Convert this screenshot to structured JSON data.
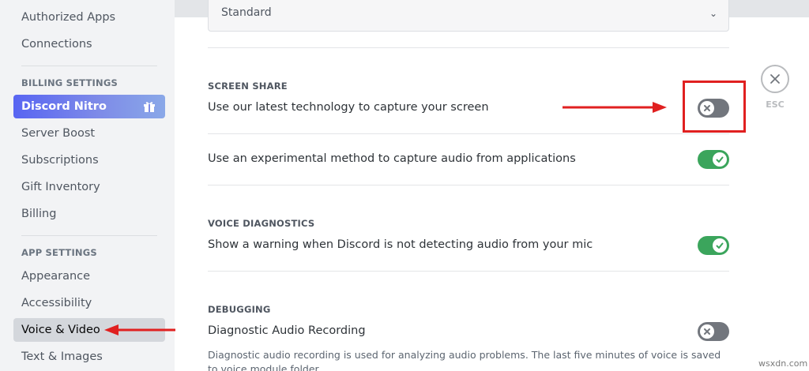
{
  "sidebar": {
    "items_top": [
      "Authorized Apps",
      "Connections"
    ],
    "billing_header": "BILLING SETTINGS",
    "billing_items": [
      "Discord Nitro",
      "Server Boost",
      "Subscriptions",
      "Gift Inventory",
      "Billing"
    ],
    "app_header": "APP SETTINGS",
    "app_items": [
      "Appearance",
      "Accessibility",
      "Voice & Video",
      "Text & Images"
    ],
    "active_item": "Voice & Video"
  },
  "main": {
    "dropdown_value": "Standard",
    "screen_share": {
      "title": "SCREEN SHARE",
      "row1_label": "Use our latest technology to capture your screen",
      "row1_enabled": false,
      "row2_label": "Use an experimental method to capture audio from applications",
      "row2_enabled": true
    },
    "voice_diagnostics": {
      "title": "VOICE DIAGNOSTICS",
      "row_label": "Show a warning when Discord is not detecting audio from your mic",
      "row_enabled": true
    },
    "debugging": {
      "title": "DEBUGGING",
      "row_label": "Diagnostic Audio Recording",
      "row_enabled": false,
      "description": "Diagnostic audio recording is used for analyzing audio problems. The last five minutes of voice is saved to voice module folder."
    }
  },
  "esc": {
    "label": "ESC"
  },
  "watermark": "wsxdn.com",
  "colors": {
    "toggle_on": "#3ba55c",
    "toggle_off": "#72767d",
    "nitro_accent": "#5865f2",
    "annotation_red": "#e02020"
  }
}
